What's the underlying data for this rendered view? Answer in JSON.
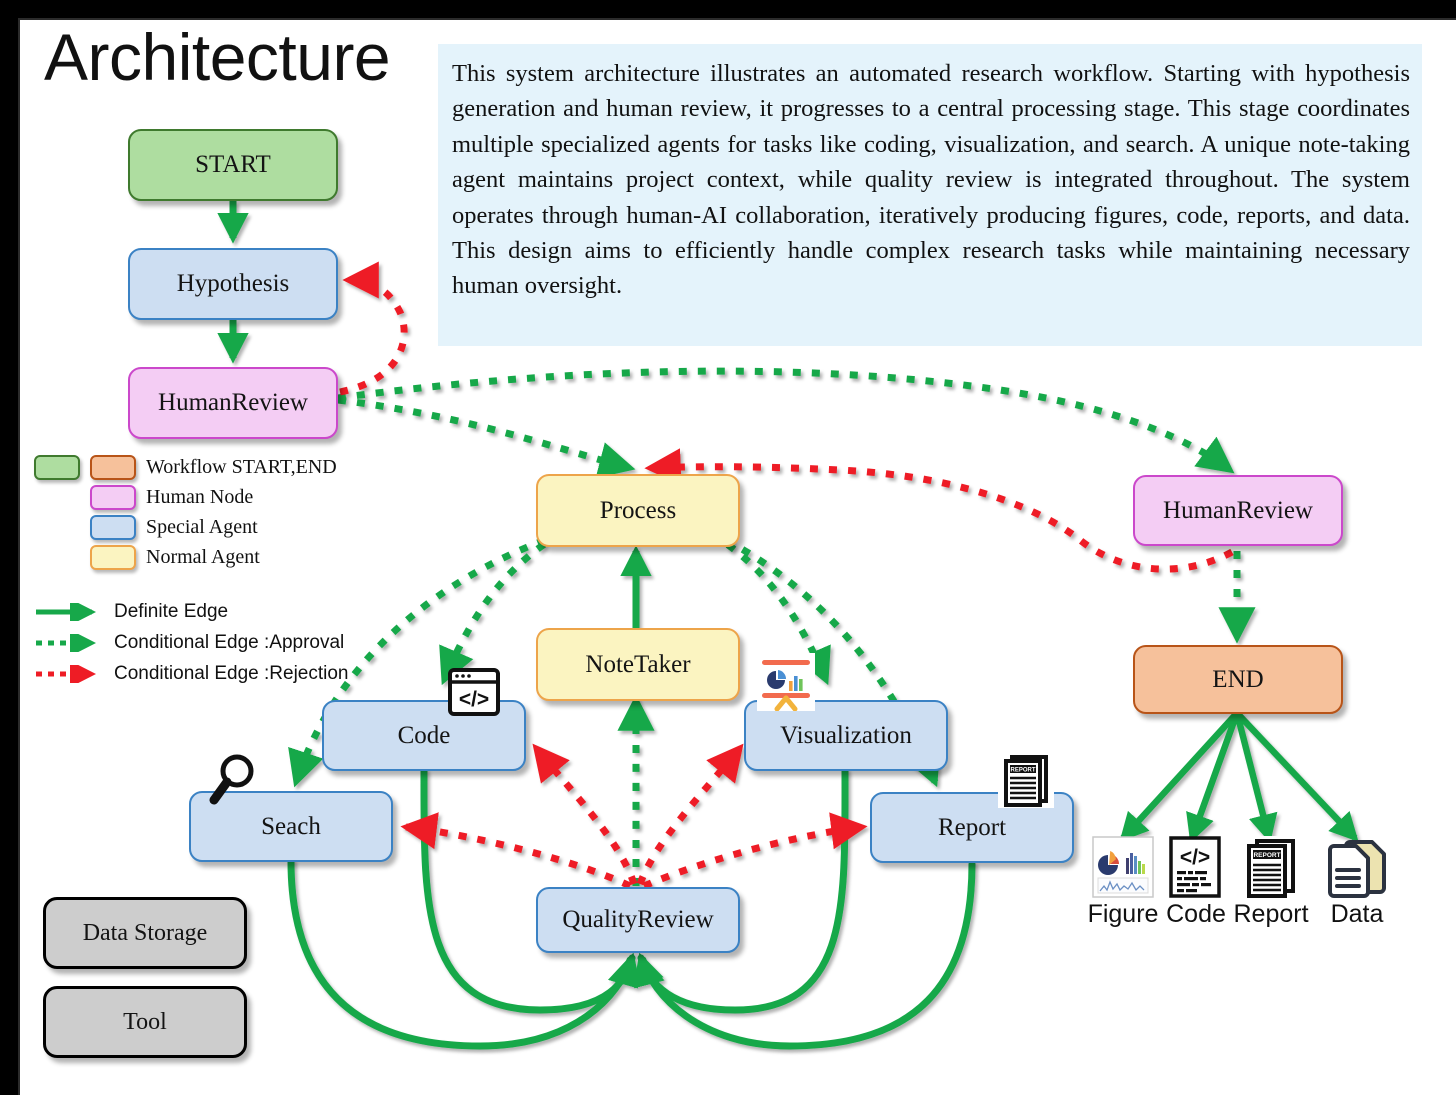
{
  "title": "Architecture",
  "description": "This system architecture illustrates an automated research workflow. Starting with hypothesis generation and human review, it progresses to a central processing stage. This stage coordinates multiple specialized agents for tasks like coding, visualization, and search. A unique note-taking agent maintains project context, while quality review is integrated throughout. The system operates through human-AI collaboration, iteratively producing figures, code, reports, and data. This design aims to efficiently handle complex research tasks while maintaining necessary human oversight.",
  "colors": {
    "start_fill": "#aedda0",
    "start_border": "#3f7a2e",
    "end_fill": "#f6c19b",
    "end_border": "#b85418",
    "human_fill": "#f4cdf4",
    "human_border": "#cb48cb",
    "agent_fill": "#cddef2",
    "agent_border": "#3b82c4",
    "normal_fill": "#fbf4c1",
    "normal_border": "#eda44a",
    "gray_fill": "#cdcdcd",
    "gray_border": "#000000",
    "definite_edge": "#17a84a",
    "approval_edge": "#17a84a",
    "rejection_edge": "#ee1c25",
    "description_bg": "#e4f3fb"
  },
  "nodes": {
    "start": "START",
    "hypothesis": "Hypothesis",
    "human_review_left": "HumanReview",
    "process": "Process",
    "note_taker": "NoteTaker",
    "code": "Code",
    "seach": "Seach",
    "visualization": "Visualization",
    "report": "Report",
    "quality_review": "QualityReview",
    "human_review_right": "HumanReview",
    "end": "END",
    "data_storage": "Data Storage",
    "tool": "Tool"
  },
  "legend": {
    "node_types": [
      {
        "label": "Workflow START,END",
        "swatches": [
          "start",
          "end"
        ]
      },
      {
        "label": "Human Node",
        "swatches": [
          "human"
        ]
      },
      {
        "label": "Special Agent",
        "swatches": [
          "agent"
        ]
      },
      {
        "label": "Normal Agent",
        "swatches": [
          "normal"
        ]
      }
    ],
    "edge_types": [
      {
        "label": "Definite Edge",
        "style": "solid",
        "color": "#17a84a"
      },
      {
        "label": "Conditional Edge :Approval",
        "style": "dotted",
        "color": "#17a84a"
      },
      {
        "label": "Conditional Edge :Rejection",
        "style": "dotted",
        "color": "#ee1c25"
      }
    ]
  },
  "outputs": [
    {
      "label": "Figure",
      "icon": "chart-figure-icon"
    },
    {
      "label": "Code",
      "icon": "code-brackets-icon"
    },
    {
      "label": "Report",
      "icon": "report-document-icon"
    },
    {
      "label": "Data",
      "icon": "data-pages-icon"
    }
  ],
  "node_icons": {
    "code": "code-window-icon",
    "seach": "magnifier-icon",
    "visualization": "presentation-chart-icon",
    "report": "report-stack-icon"
  }
}
